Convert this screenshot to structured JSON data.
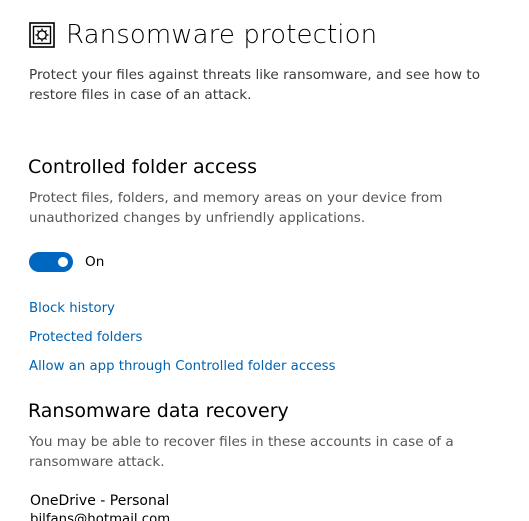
{
  "header": {
    "icon": "ransomware-protection-icon",
    "title": "Ransomware protection"
  },
  "intro": {
    "text": "Protect your files against threats like ransomware, and see how to restore files in case of an attack."
  },
  "controlled_folder_access": {
    "title": "Controlled folder access",
    "description": "Protect files, folders, and memory areas on your device from unauthorized changes by unfriendly applications.",
    "toggle": {
      "state": true,
      "label": "On"
    },
    "links": {
      "block_history": "Block history",
      "protected_folders": "Protected folders",
      "allow_app": "Allow an app through Controlled folder access"
    }
  },
  "data_recovery": {
    "title": "Ransomware data recovery",
    "description": "You may be able to recover files in these accounts in case of a ransomware attack.",
    "account": {
      "name": "OneDrive - Personal",
      "email": "bilfans@hotmail.com"
    }
  },
  "colors": {
    "accent": "#0067c0",
    "link": "#0063b1",
    "text": "#000000",
    "secondary_text": "#555555"
  }
}
